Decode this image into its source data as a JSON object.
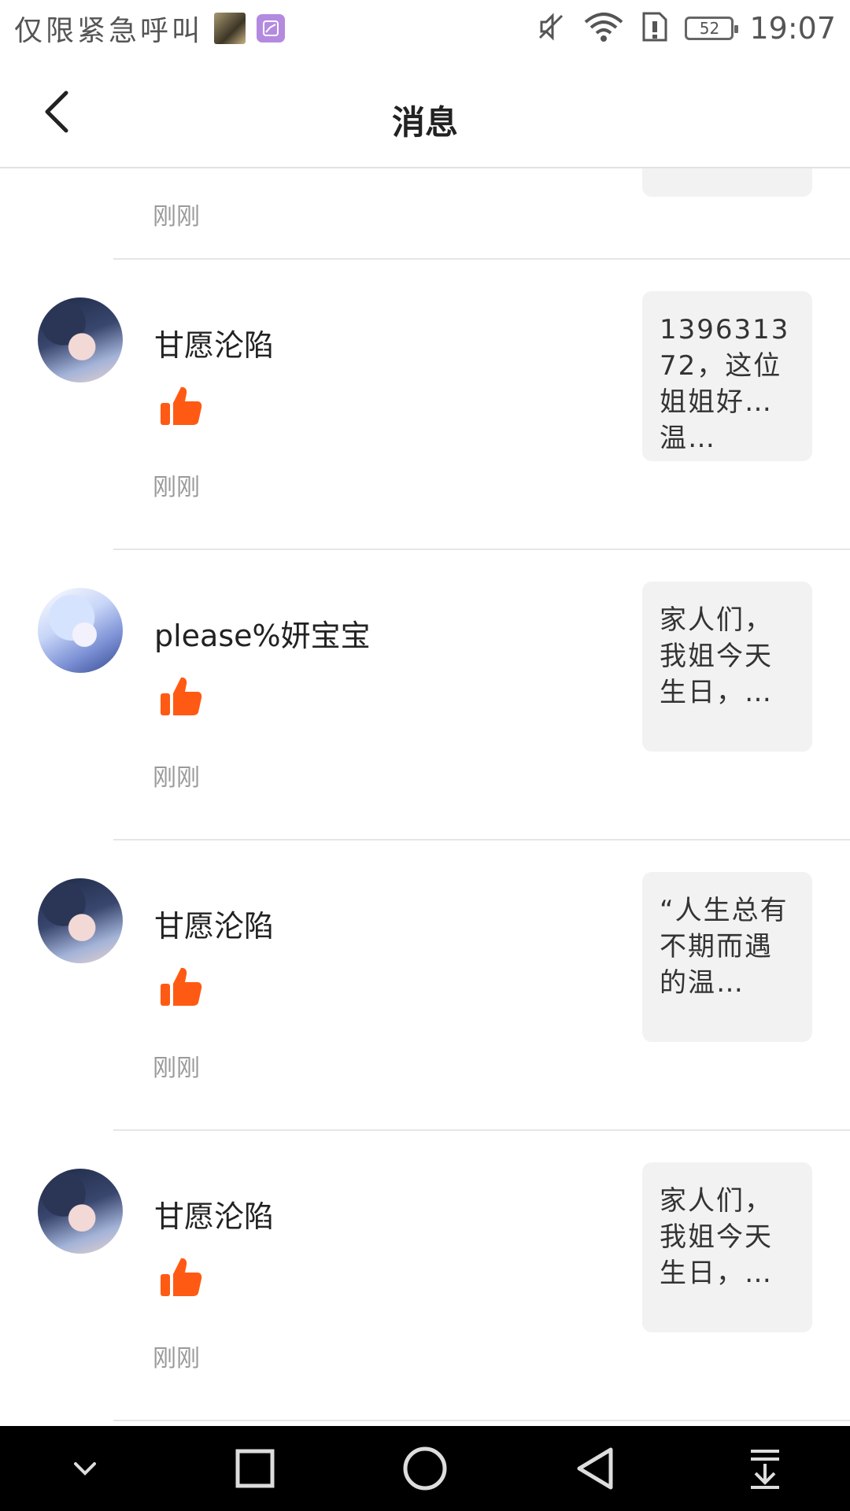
{
  "status_bar": {
    "carrier": "仅限紧急呼叫",
    "battery": "52",
    "time": "19:07",
    "icons": [
      "photo-thumbnail-icon",
      "gallery-icon",
      "mute-icon",
      "wifi-icon",
      "sim-alert-icon",
      "battery-icon"
    ]
  },
  "header": {
    "title": "消息",
    "back_icon": "chevron-left-icon"
  },
  "list": {
    "partial_item": {
      "time": "刚刚"
    },
    "items": [
      {
        "username": "甘愿沦陷",
        "avatar": "anime-avatar-dark-hair",
        "action_icon": "thumbs-up-icon",
        "time": "刚刚",
        "preview": "139631372，这位姐姐好温…"
      },
      {
        "username": "please%妍宝宝",
        "avatar": "anime-avatar-white-hair",
        "action_icon": "thumbs-up-icon",
        "time": "刚刚",
        "preview": "家人们，我姐今天生日，…"
      },
      {
        "username": "甘愿沦陷",
        "avatar": "anime-avatar-dark-hair",
        "action_icon": "thumbs-up-icon",
        "time": "刚刚",
        "preview": "“人生总有不期而遇的温…"
      },
      {
        "username": "甘愿沦陷",
        "avatar": "anime-avatar-dark-hair",
        "action_icon": "thumbs-up-icon",
        "time": "刚刚",
        "preview": "家人们，我姐今天生日，…"
      }
    ]
  },
  "colors": {
    "like": "#ff5a14",
    "preview_bg": "#f2f2f2",
    "time_text": "#9a9a9a"
  },
  "nav_bar": {
    "buttons": [
      "collapse-icon",
      "recents-square-icon",
      "home-circle-icon",
      "back-triangle-icon",
      "notification-pulldown-icon"
    ]
  }
}
